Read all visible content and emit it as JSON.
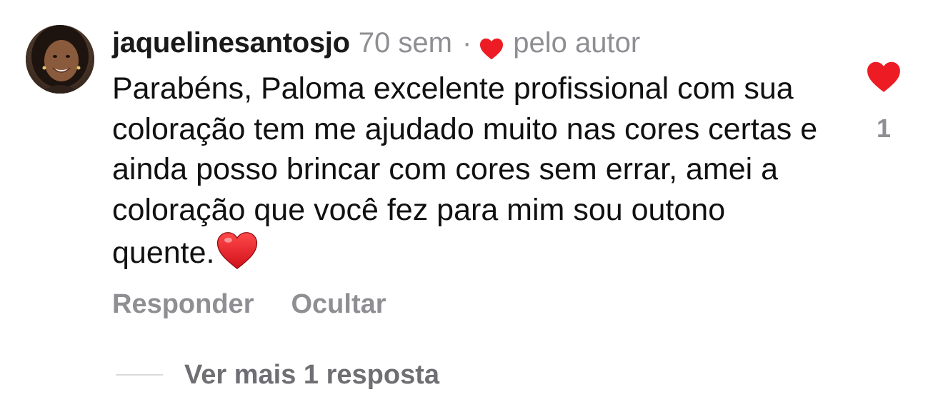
{
  "comment": {
    "username": "jaquelinesantosjo",
    "time": "70 sem",
    "separator": "·",
    "by_author": "pelo autor",
    "text": "Parabéns, Paloma excelente profissional com sua coloração tem me ajudado muito nas cores certas e ainda posso brincar com cores sem errar, amei a coloração que você fez para mim sou outono quente.",
    "inline_emoji": "red-heart-emoji",
    "like_count": "1",
    "liked": true
  },
  "actions": {
    "reply_label": "Responder",
    "hide_label": "Ocultar"
  },
  "replies": {
    "label": "Ver mais 1 resposta"
  },
  "icons": {
    "author_like": "heart-icon",
    "like_button": "heart-icon"
  },
  "colors": {
    "heart": "#ed1c24",
    "secondary_text": "#8e8e93",
    "primary_text": "#111111"
  }
}
